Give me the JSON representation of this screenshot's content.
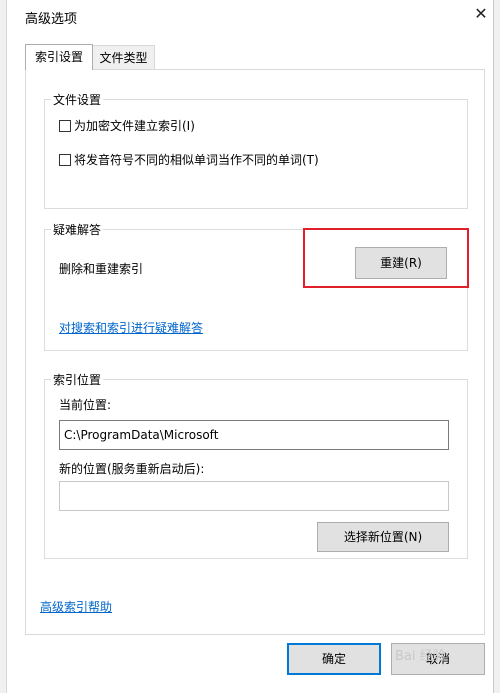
{
  "window": {
    "title": "高级选项"
  },
  "tabs": [
    {
      "label": "索引设置",
      "active": true
    },
    {
      "label": "文件类型",
      "active": false
    }
  ],
  "file_settings": {
    "legend": "文件设置",
    "options": [
      {
        "label": "为加密文件建立索引(I)",
        "checked": false
      },
      {
        "label": "将发音符号不同的相似单词当作不同的单词(T)",
        "checked": false
      }
    ]
  },
  "troubleshoot": {
    "legend": "疑难解答",
    "rebuild_text": "删除和重建索引",
    "rebuild_button": "重建(R)",
    "link": "对搜索和索引进行疑难解答"
  },
  "index_location": {
    "legend": "索引位置",
    "current_label": "当前位置:",
    "current_value": "C:\\ProgramData\\Microsoft",
    "new_label": "新的位置(服务重新启动后):",
    "new_value": "",
    "select_button": "选择新位置(N)"
  },
  "help_link": "高级索引帮助",
  "footer": {
    "ok": "确定",
    "cancel": "取消"
  },
  "watermark": "Bai 经验",
  "colors": {
    "highlight": "#e0202a",
    "link": "#0066cc"
  }
}
